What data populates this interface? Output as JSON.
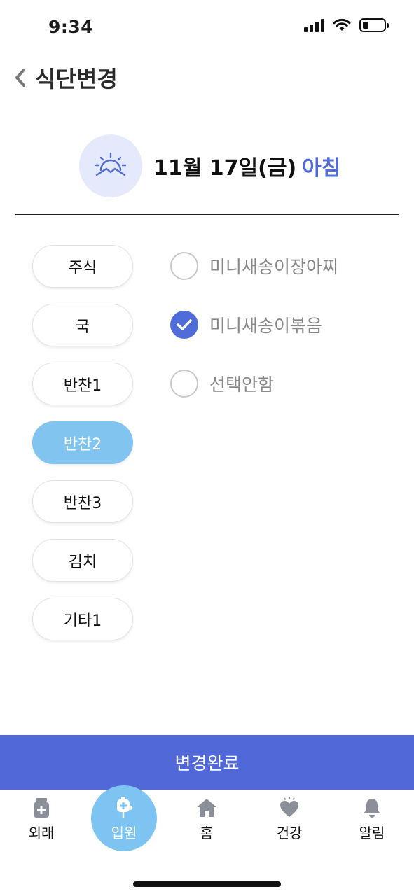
{
  "status_bar": {
    "time": "9:34"
  },
  "header": {
    "title": "식단변경"
  },
  "meal": {
    "date": "11월 17일(금)",
    "time_of_day": "아침"
  },
  "categories": [
    {
      "label": "주식",
      "active": false
    },
    {
      "label": "국",
      "active": false
    },
    {
      "label": "반찬1",
      "active": false
    },
    {
      "label": "반찬2",
      "active": true
    },
    {
      "label": "반찬3",
      "active": false
    },
    {
      "label": "김치",
      "active": false
    },
    {
      "label": "기타1",
      "active": false
    }
  ],
  "options": [
    {
      "label": "미니새송이장아찌",
      "checked": false
    },
    {
      "label": "미니새송이볶음",
      "checked": true
    },
    {
      "label": "선택안함",
      "checked": false
    }
  ],
  "confirm_button": {
    "label": "변경완료"
  },
  "tab_bar": {
    "tabs": [
      {
        "label": "외래",
        "icon": "medicine-bottle-icon",
        "active": false
      },
      {
        "label": "입원",
        "icon": "iv-drip-icon",
        "active": true
      },
      {
        "label": "홈",
        "icon": "home-icon",
        "active": false
      },
      {
        "label": "건강",
        "icon": "heart-icon",
        "active": false
      },
      {
        "label": "알림",
        "icon": "bell-icon",
        "active": false
      }
    ]
  },
  "colors": {
    "accent": "#5068d8",
    "active_pill": "#82c4f0",
    "meal_time": "#4f6cd9",
    "icon_circle": "#e4e9fb"
  }
}
